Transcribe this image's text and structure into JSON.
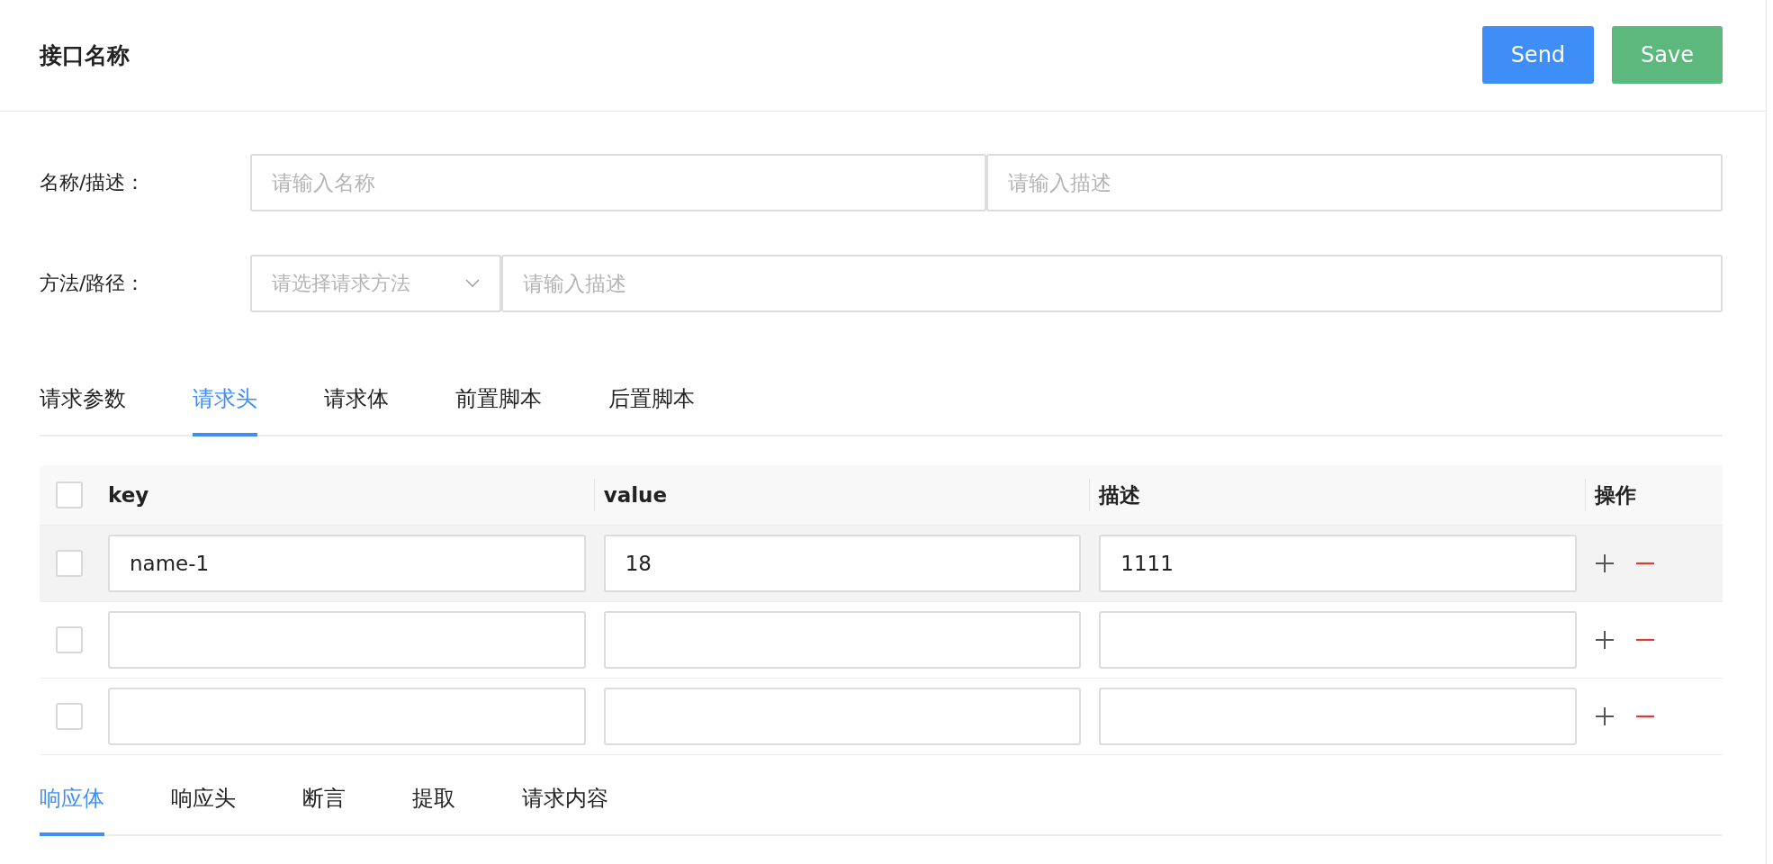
{
  "header": {
    "title": "接口名称",
    "buttons": [
      {
        "label": "Send",
        "kind": "primary"
      },
      {
        "label": "Save",
        "kind": "success"
      }
    ]
  },
  "form": {
    "rows": [
      {
        "label": "名称/描述：",
        "fields": [
          {
            "kind": "input",
            "placeholder": "请输入名称"
          },
          {
            "kind": "input",
            "placeholder": "请输入描述"
          }
        ]
      },
      {
        "label": "方法/路径：",
        "fields": [
          {
            "kind": "select",
            "placeholder": "请选择请求方法"
          },
          {
            "kind": "input",
            "placeholder": "请输入描述"
          }
        ]
      }
    ]
  },
  "request_tabs": [
    {
      "label": "请求参数",
      "selected": false
    },
    {
      "label": "请求头",
      "selected": true
    },
    {
      "label": "请求体",
      "selected": false
    },
    {
      "label": "前置脚本",
      "selected": false
    },
    {
      "label": "后置脚本",
      "selected": false
    }
  ],
  "headers_table": {
    "columns": [
      "key",
      "value",
      "描述",
      "操作"
    ],
    "header_checked": false,
    "rows": [
      {
        "checked": false,
        "hovered": true,
        "key": "name-1",
        "value": "18",
        "description": "1111"
      },
      {
        "checked": false,
        "hovered": false
      },
      {
        "checked": false,
        "hovered": false
      }
    ]
  },
  "response_tabs": [
    {
      "label": "响应体",
      "selected": true
    },
    {
      "label": "响应头",
      "selected": false
    },
    {
      "label": "断言",
      "selected": false
    },
    {
      "label": "提取",
      "selected": false
    },
    {
      "label": "请求内容",
      "selected": false
    }
  ]
}
